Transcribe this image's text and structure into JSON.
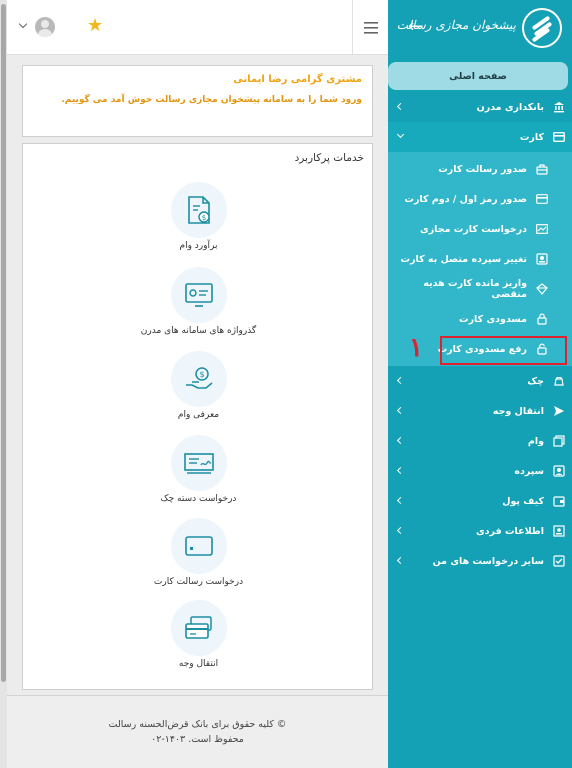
{
  "user_card": {
    "name": "مشتری گرامی رضا ایمانی",
    "welcome": "ورود شما را به سامانه پیشخوان مجازی رسالت خوش آمد می گوییم."
  },
  "services": {
    "title": "خدمات پرکاربرد",
    "items": [
      {
        "label": "برآورد وام",
        "icon": "loan-estimate-icon"
      },
      {
        "label": "گذرواژه های سامانه های مدرن",
        "icon": "modern-password-icon"
      },
      {
        "label": "معرفی وام",
        "icon": "loan-intro-icon"
      },
      {
        "label": "درخواست دسته چک",
        "icon": "checkbook-icon"
      },
      {
        "label": "درخواست رسالت کارت",
        "icon": "card-icon"
      },
      {
        "label": "انتقال وجه",
        "icon": "transfer-icon"
      }
    ]
  },
  "footer": {
    "line1": "© کلیه حقوق برای بانک قرض‌الحسنه رسالت",
    "line2": "محفوظ است. ۱۴۰۳-۰۲"
  },
  "sidebar": {
    "brand": "پیشخوان مجازی رسالت",
    "items": [
      {
        "label": "صفحه اصلی",
        "icon": "home-icon"
      },
      {
        "label": "بانکداری مدرن",
        "icon": "bank-icon"
      },
      {
        "label": "کارت",
        "icon": "card-icon"
      },
      {
        "label": "چک",
        "icon": "check-icon"
      },
      {
        "label": "انتقال وجه",
        "icon": "send-icon"
      },
      {
        "label": "وام",
        "icon": "loan-icon"
      },
      {
        "label": "سپرده",
        "icon": "deposit-icon"
      },
      {
        "label": "کیف پول",
        "icon": "wallet-icon"
      },
      {
        "label": "اطلاعات فردی",
        "icon": "profile-icon"
      },
      {
        "label": "سایر درخواست های من",
        "icon": "requests-icon"
      }
    ],
    "card_subitems": [
      {
        "label": "صدور رسالت کارت",
        "icon": "issue-card-icon"
      },
      {
        "label": "صدور رمز اول / دوم کارت",
        "icon": "card-pin-icon"
      },
      {
        "label": "درخواست کارت مجازی",
        "icon": "virtual-card-icon"
      },
      {
        "label": "تغییر سپرده متصل به کارت",
        "icon": "linked-deposit-icon"
      },
      {
        "label": "واریز مانده کارت هدیه منقضی",
        "icon": "gift-card-icon"
      },
      {
        "label": "مسدودی کارت",
        "icon": "lock-icon"
      },
      {
        "label": "رفع مسدودی کارت",
        "icon": "unlock-icon"
      }
    ]
  },
  "annotation": {
    "marker": "۱",
    "color": "#e0212e"
  },
  "colors": {
    "sidebar": "#14a1b5",
    "accent": "#f2b81b",
    "welcome_text": "#f0a215"
  }
}
